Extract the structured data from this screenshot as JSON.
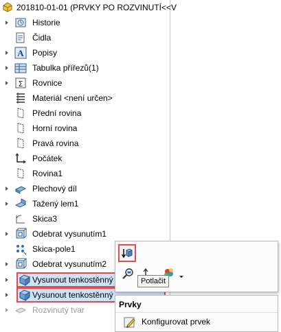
{
  "tree": {
    "root_label": "201810-01-01  (PRVKY PO ROZVINUTÍ<<V",
    "items": [
      {
        "label": "Historie",
        "icon": "history-folder-icon"
      },
      {
        "label": "Čidla",
        "icon": "sensors-icon"
      },
      {
        "label": "Popisy",
        "icon": "annotations-icon"
      },
      {
        "label": "Tabulka přířezů(1)",
        "icon": "cut-list-icon"
      },
      {
        "label": "Rovnice",
        "icon": "equations-icon"
      },
      {
        "label": "Materiál <není určen>",
        "icon": "material-icon"
      },
      {
        "label": "Přední rovina",
        "icon": "plane-icon"
      },
      {
        "label": "Horní rovina",
        "icon": "plane-icon"
      },
      {
        "label": "Pravá rovina",
        "icon": "plane-icon"
      },
      {
        "label": "Počátek",
        "icon": "origin-icon"
      },
      {
        "label": "Rovina1",
        "icon": "plane-icon"
      },
      {
        "label": "Plechový díl",
        "icon": "sheet-metal-icon"
      },
      {
        "label": "Tažený lem1",
        "icon": "edge-flange-icon"
      },
      {
        "label": "Skica3",
        "icon": "sketch-icon"
      },
      {
        "label": "Odebrat vysunutím1",
        "icon": "cut-extrude-icon"
      },
      {
        "label": "Skica-pole1",
        "icon": "sketch-pattern-icon"
      },
      {
        "label": "Odebrat vysunutím2",
        "icon": "cut-extrude-icon"
      },
      {
        "label": "Vysunout tenkostěnný",
        "icon": "thin-extrude-icon"
      },
      {
        "label": "Vysunout tenkostěnný",
        "icon": "thin-extrude-icon"
      },
      {
        "label": "Rozvinutý tvar",
        "icon": "flat-pattern-icon"
      }
    ]
  },
  "context_toolbar": {
    "suppress_tooltip": "Potlačit"
  },
  "context_menu": {
    "header": "Prvky",
    "item": "Konfigurovat prvek"
  },
  "colors": {
    "highlight_border": "#e14b4b",
    "highlight_fill": "#cfe3f7"
  }
}
